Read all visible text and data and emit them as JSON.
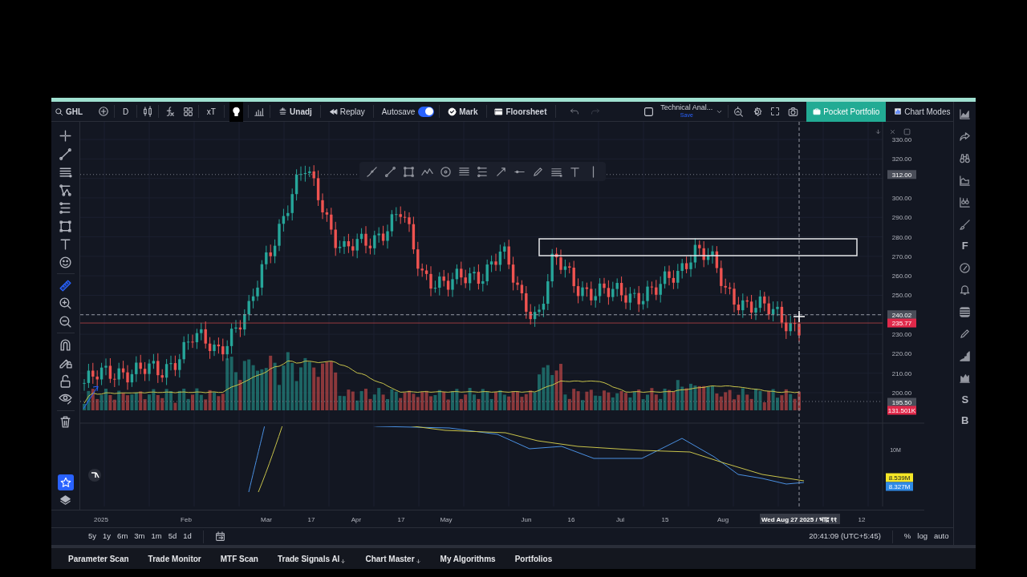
{
  "toolbar": {
    "symbol": "GHL",
    "interval": "D",
    "studies_label": "xT",
    "adjust": "Unadj",
    "replay": "Replay",
    "autosave": {
      "label": "Autosave",
      "on": true
    },
    "mark": "Mark",
    "floorsheet": "Floorsheet",
    "layout": {
      "name": "Technical Anal...",
      "status": "Save"
    },
    "pocket_portfolio": "Pocket Portfolio",
    "chart_modes": "Chart Modes"
  },
  "left_tools": [
    {
      "selected": false
    },
    {
      "selected": false
    },
    {
      "selected": false
    },
    {
      "selected": false
    },
    {
      "selected": false
    },
    {
      "selected": false
    },
    {
      "selected": false
    },
    {
      "selected": false
    },
    {
      "selected": true
    },
    {
      "selected": false
    },
    {
      "selected": false
    },
    {
      "selected": false
    },
    {
      "selected": false
    },
    {
      "selected": false
    },
    {
      "selected": false
    },
    {
      "selected": false
    }
  ],
  "favorites_button": {
    "selected": true
  },
  "right_tools": [
    {
      "kind": "icon"
    },
    {
      "kind": "icon"
    },
    {
      "kind": "icon"
    },
    {
      "kind": "icon"
    },
    {
      "kind": "icon"
    },
    {
      "kind": "icon"
    },
    {
      "kind": "letter",
      "text": "F"
    },
    {
      "kind": "icon"
    },
    {
      "kind": "icon"
    },
    {
      "kind": "icon"
    },
    {
      "kind": "icon"
    },
    {
      "kind": "icon"
    },
    {
      "kind": "icon"
    },
    {
      "kind": "letter",
      "text": "S"
    },
    {
      "kind": "letter",
      "text": "B"
    }
  ],
  "price_axis": {
    "labels": [
      "330.00",
      "320.00",
      "300.00",
      "290.00",
      "280.00",
      "270.00",
      "260.00",
      "250.00",
      "230.00",
      "220.00",
      "210.00",
      "200.00"
    ],
    "markers": [
      {
        "text": "312.00",
        "color": "#4a4e59"
      },
      {
        "text": "240.02",
        "color": "#4a4e59"
      },
      {
        "text": "235.77",
        "color": "#e0294a"
      },
      {
        "text": "195.50",
        "color": "#4a4e59"
      },
      {
        "text": "131.501K",
        "color": "#e0294a"
      }
    ]
  },
  "indicator_axis": {
    "labels": [
      "10M"
    ],
    "markers": [
      {
        "text": "8.539M",
        "color": "#f5e727"
      },
      {
        "text": "8.327M",
        "color": "#2e8ae6"
      }
    ]
  },
  "time_axis": {
    "labels": [
      "2025",
      "Feb",
      "Mar",
      "17",
      "Apr",
      "17",
      "May",
      "Jun",
      "16",
      "Jul",
      "15",
      "Aug",
      "12"
    ],
    "cursor_label": "Wed Aug 27 2025 / भाद्र ११"
  },
  "ranges": [
    "5y",
    "1y",
    "6m",
    "3m",
    "1m",
    "5d",
    "1d"
  ],
  "clock": "20:41:09 (UTC+5:45)",
  "scale_options": [
    "%",
    "log",
    "auto"
  ],
  "bottom_tabs": [
    {
      "label": "Parameter Scan",
      "dropdown": false
    },
    {
      "label": "Trade Monitor",
      "dropdown": false
    },
    {
      "label": "MTF Scan",
      "dropdown": false
    },
    {
      "label": "Trade Signals AI",
      "dropdown": true
    },
    {
      "label": "Chart Master",
      "dropdown": true
    },
    {
      "label": "My Algorithms",
      "dropdown": false
    },
    {
      "label": "Portfolios",
      "dropdown": false
    }
  ]
}
